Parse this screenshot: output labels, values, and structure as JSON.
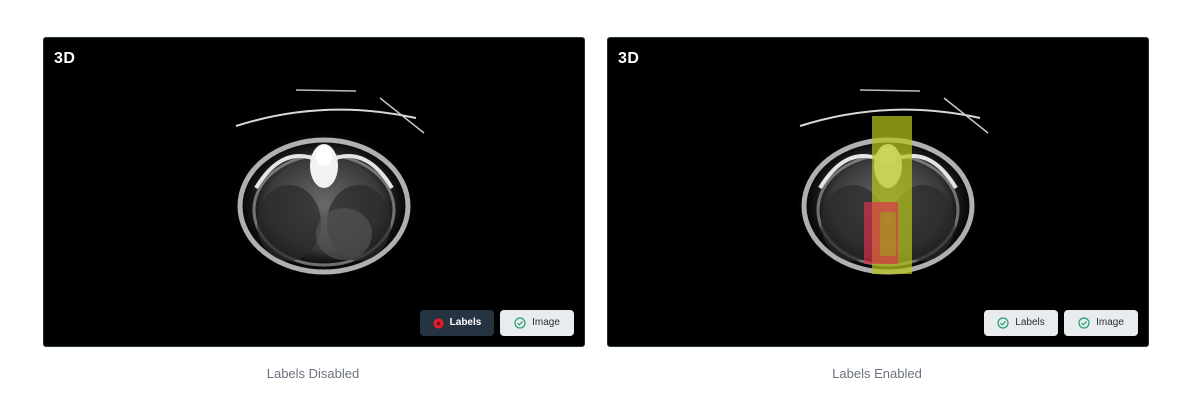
{
  "panels": [
    {
      "view_label": "3D",
      "caption": "Labels Disabled",
      "buttons": {
        "labels": "Labels",
        "image": "Image"
      },
      "labels_enabled": false
    },
    {
      "view_label": "3D",
      "caption": "Labels Enabled",
      "buttons": {
        "labels": "Labels",
        "image": "Image"
      },
      "labels_enabled": true
    }
  ],
  "colors": {
    "panel_background": "#000000",
    "labels_off_button": "#263442",
    "toggle_on_button": "#e8ecef",
    "check_green": "#22a06b",
    "labels_off_dot": "#e11d2e",
    "overlay_yellow": "#b5c21a",
    "overlay_red": "#e0314f"
  }
}
